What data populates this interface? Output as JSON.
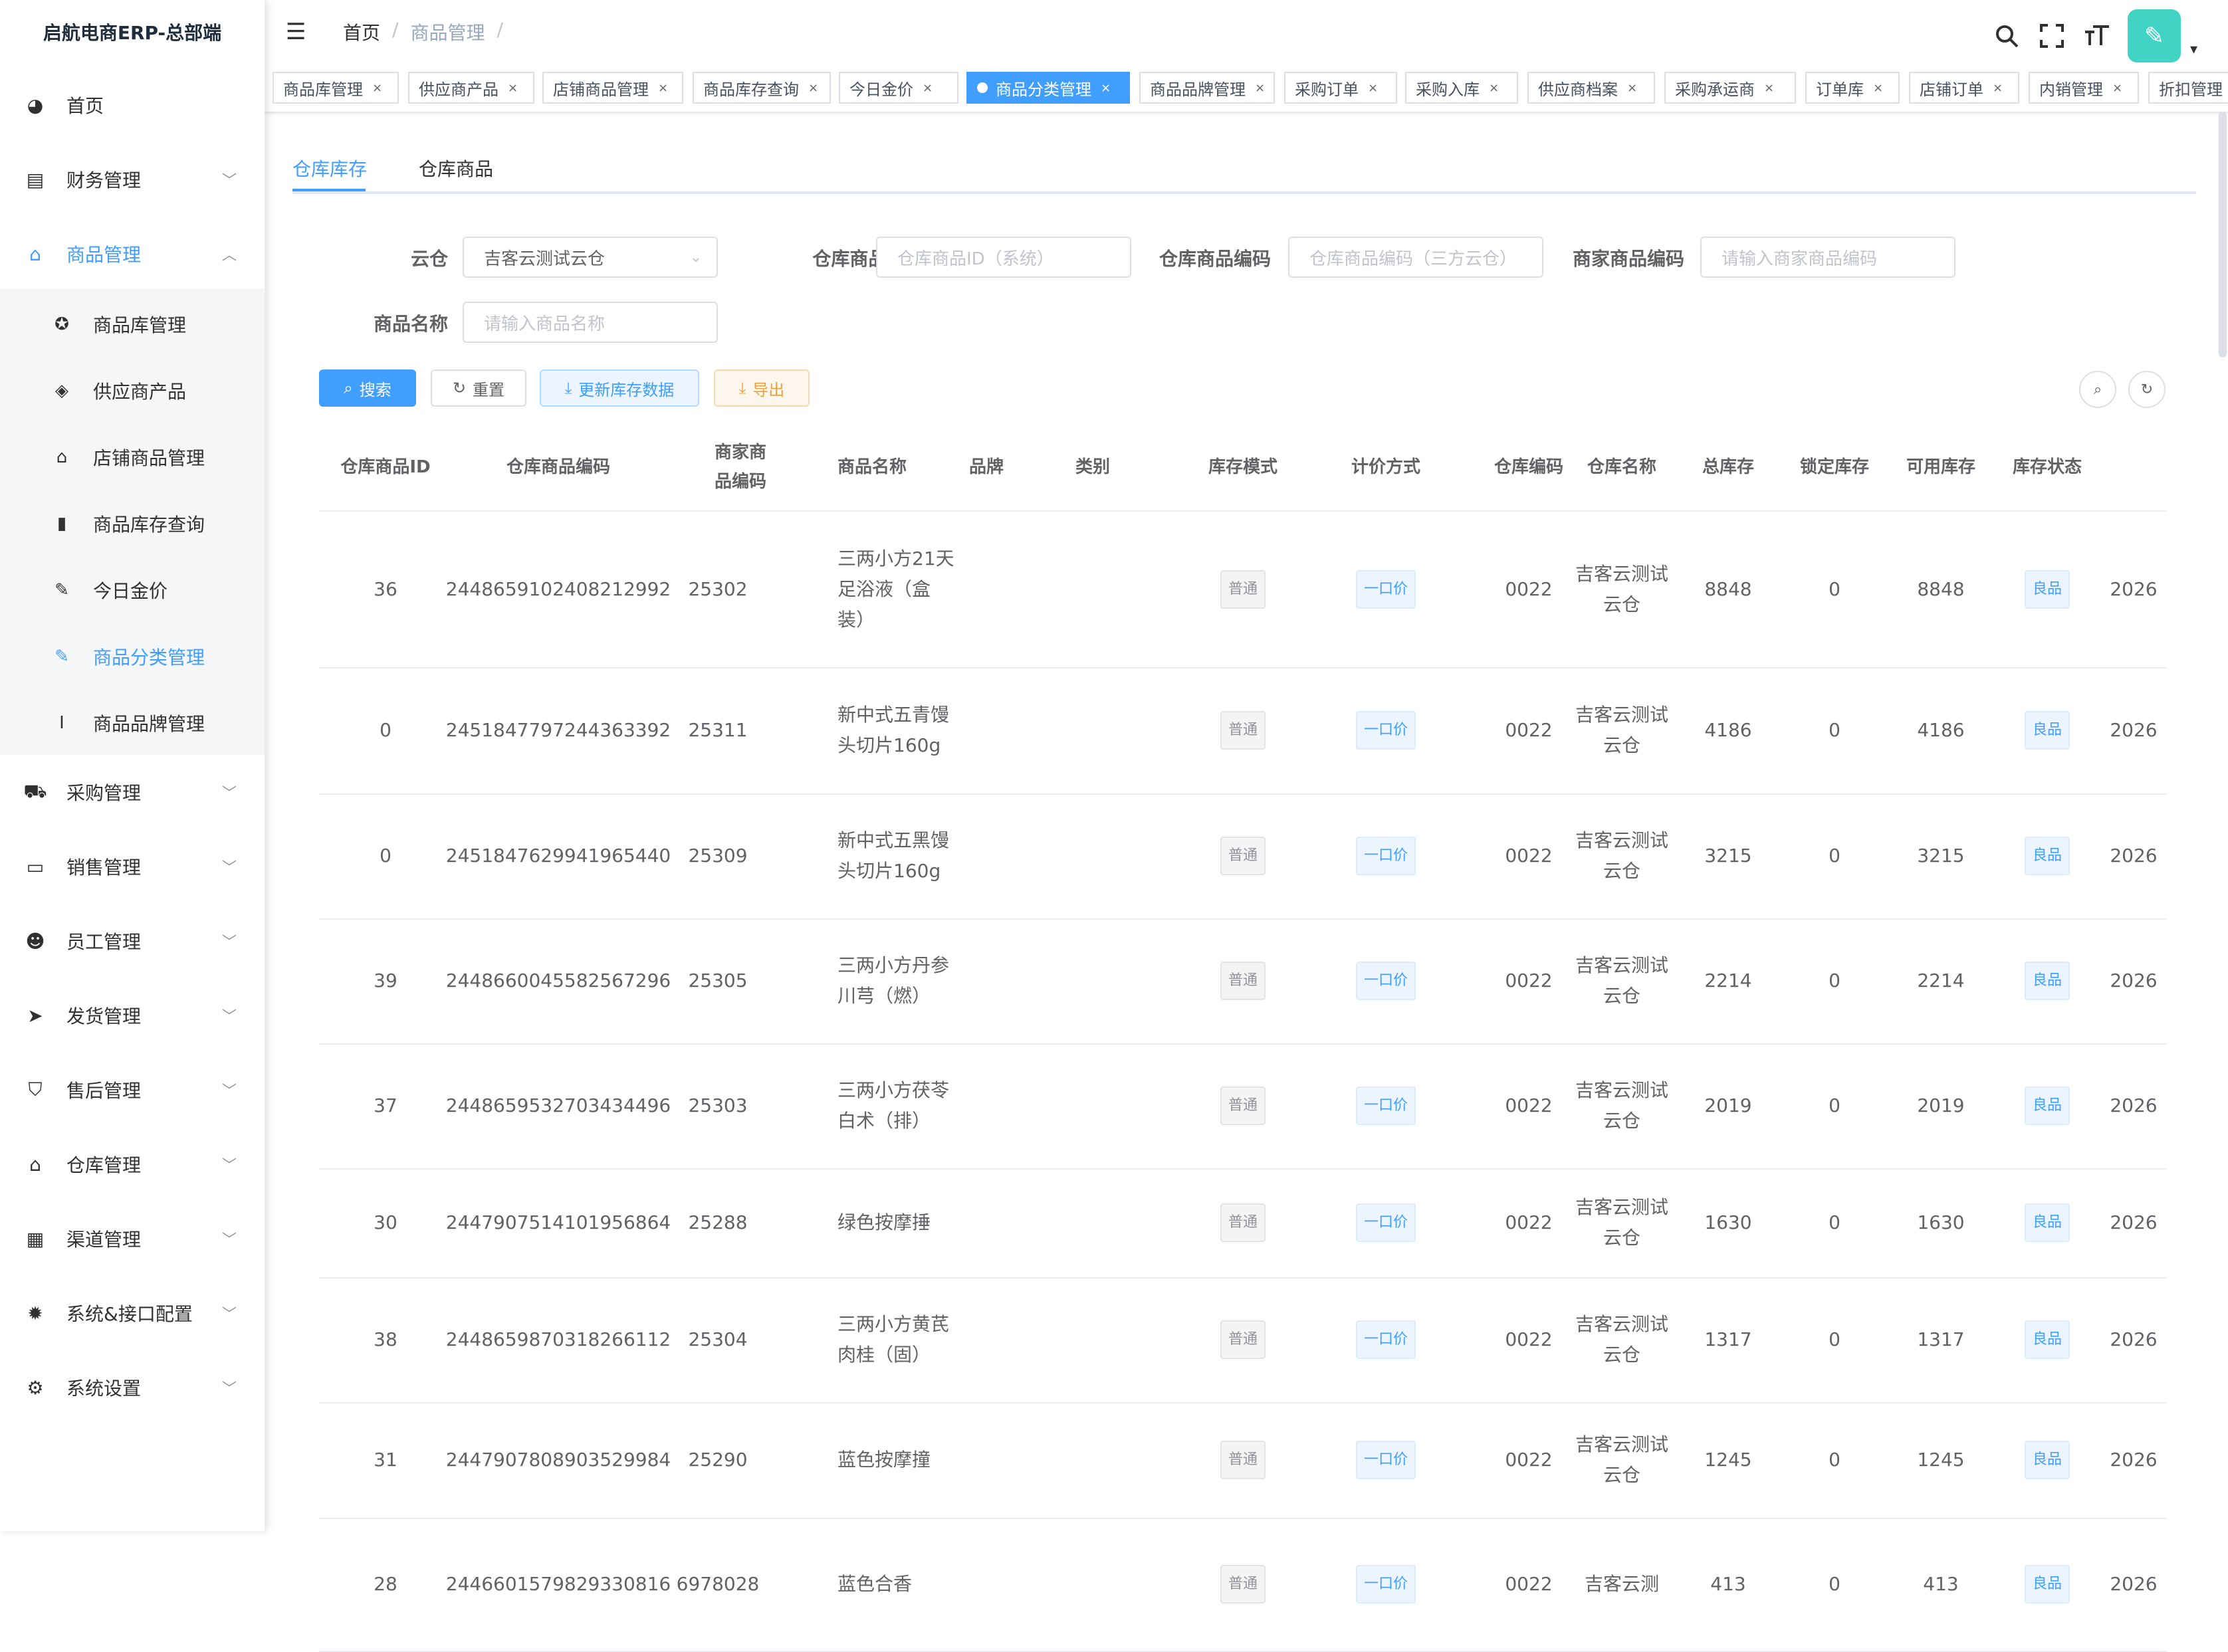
{
  "app": {
    "title": "启航电商ERP-总部端"
  },
  "sidebar": {
    "items": [
      {
        "icon": "dashboard-icon",
        "label": "首页"
      },
      {
        "icon": "finance-icon",
        "label": "财务管理"
      },
      {
        "icon": "goods-icon",
        "label": "商品管理"
      },
      {
        "icon": "cart-icon",
        "label": "采购管理"
      },
      {
        "icon": "sales-icon",
        "label": "销售管理"
      },
      {
        "icon": "staff-icon",
        "label": "员工管理"
      },
      {
        "icon": "send-icon",
        "label": "发货管理"
      },
      {
        "icon": "aftersale-icon",
        "label": "售后管理"
      },
      {
        "icon": "warehouse-icon",
        "label": "仓库管理"
      },
      {
        "icon": "channel-icon",
        "label": "渠道管理"
      },
      {
        "icon": "system-api-icon",
        "label": "系统&接口配置"
      },
      {
        "icon": "settings-icon",
        "label": "系统设置"
      }
    ],
    "submenu": [
      {
        "icon": "library-icon",
        "label": "商品库管理"
      },
      {
        "icon": "supplier-icon",
        "label": "供应商产品"
      },
      {
        "icon": "shop-icon",
        "label": "店铺商品管理"
      },
      {
        "icon": "bar-chart-icon",
        "label": "商品库存查询"
      },
      {
        "icon": "gold-price-icon",
        "label": "今日金价"
      },
      {
        "icon": "edit-icon",
        "label": "商品分类管理"
      },
      {
        "icon": "brand-icon",
        "label": "商品品牌管理"
      }
    ]
  },
  "header": {
    "breadcrumb": {
      "home": "首页",
      "sep1": "/",
      "current": "商品管理",
      "sep2": "/"
    },
    "hamburger": "☰",
    "search": "⌕",
    "fullscreen": "⛶",
    "fontsize": "тT",
    "avatar": "✎",
    "caret": "▾"
  },
  "tags": [
    {
      "label": "商品库管理",
      "close": "×"
    },
    {
      "label": "供应商产品",
      "close": "×"
    },
    {
      "label": "店铺商品管理",
      "close": "×"
    },
    {
      "label": "商品库存查询",
      "close": "×"
    },
    {
      "label": "今日金价",
      "close": "×"
    },
    {
      "label": "商品分类管理",
      "close": "×"
    },
    {
      "label": "商品品牌管理",
      "close": "×"
    },
    {
      "label": "采购订单",
      "close": "×"
    },
    {
      "label": "采购入库",
      "close": "×"
    },
    {
      "label": "供应商档案",
      "close": "×"
    },
    {
      "label": "采购承运商",
      "close": "×"
    },
    {
      "label": "订单库",
      "close": "×"
    },
    {
      "label": "店铺订单",
      "close": "×"
    },
    {
      "label": "内销管理",
      "close": "×"
    },
    {
      "label": "折扣管理",
      "close": ""
    }
  ],
  "tabs": [
    {
      "label": "仓库库存"
    },
    {
      "label": "仓库商品"
    }
  ],
  "form": {
    "cloud_warehouse": {
      "label": "云仓",
      "value": "吉客云测试云仓"
    },
    "warehouse_goods_id": {
      "label": "仓库商品ID",
      "placeholder": "仓库商品ID（系统）"
    },
    "warehouse_goods_code": {
      "label": "仓库商品编码",
      "placeholder": "仓库商品编码（三方云仓）"
    },
    "merchant_goods_code": {
      "label": "商家商品编码",
      "placeholder": "请输入商家商品编码"
    },
    "goods_name": {
      "label": "商品名称",
      "placeholder": "请输入商品名称"
    }
  },
  "buttons": {
    "search": "搜索",
    "reset": "重置",
    "update": "更新库存数据",
    "export": "导出"
  },
  "table": {
    "columns": [
      "仓库商品ID",
      "仓库商品编码",
      "商家商品编码",
      "商品名称",
      "品牌",
      "类别",
      "库存模式",
      "计价方式",
      "仓库编码",
      "仓库名称",
      "总库存",
      "锁定库存",
      "可用库存",
      "库存状态"
    ],
    "rows": [
      {
        "id": "36",
        "code": "2448659102408212992",
        "mcode": "25302",
        "name": "三两小方21天足浴液（盒装）",
        "brand": "",
        "category": "",
        "mode": "普通",
        "pricing": "一口价",
        "wcode": "0022",
        "wname": "吉客云测试云仓",
        "total": "8848",
        "locked": "0",
        "avail": "8848",
        "status": "良品",
        "date": "2026"
      },
      {
        "id": "0",
        "code": "2451847797244363392",
        "mcode": "25311",
        "name": "新中式五青馒头切片160g",
        "brand": "",
        "category": "",
        "mode": "普通",
        "pricing": "一口价",
        "wcode": "0022",
        "wname": "吉客云测试云仓",
        "total": "4186",
        "locked": "0",
        "avail": "4186",
        "status": "良品",
        "date": "2026"
      },
      {
        "id": "0",
        "code": "2451847629941965440",
        "mcode": "25309",
        "name": "新中式五黑馒头切片160g",
        "brand": "",
        "category": "",
        "mode": "普通",
        "pricing": "一口价",
        "wcode": "0022",
        "wname": "吉客云测试云仓",
        "total": "3215",
        "locked": "0",
        "avail": "3215",
        "status": "良品",
        "date": "2026"
      },
      {
        "id": "39",
        "code": "2448660045582567296",
        "mcode": "25305",
        "name": "三两小方丹参川芎（燃）",
        "brand": "",
        "category": "",
        "mode": "普通",
        "pricing": "一口价",
        "wcode": "0022",
        "wname": "吉客云测试云仓",
        "total": "2214",
        "locked": "0",
        "avail": "2214",
        "status": "良品",
        "date": "2026"
      },
      {
        "id": "37",
        "code": "2448659532703434496",
        "mcode": "25303",
        "name": "三两小方茯苓白术（排）",
        "brand": "",
        "category": "",
        "mode": "普通",
        "pricing": "一口价",
        "wcode": "0022",
        "wname": "吉客云测试云仓",
        "total": "2019",
        "locked": "0",
        "avail": "2019",
        "status": "良品",
        "date": "2026"
      },
      {
        "id": "30",
        "code": "2447907514101956864",
        "mcode": "25288",
        "name": "绿色按摩捶",
        "brand": "",
        "category": "",
        "mode": "普通",
        "pricing": "一口价",
        "wcode": "0022",
        "wname": "吉客云测试云仓",
        "total": "1630",
        "locked": "0",
        "avail": "1630",
        "status": "良品",
        "date": "2026"
      },
      {
        "id": "38",
        "code": "2448659870318266112",
        "mcode": "25304",
        "name": "三两小方黄芪肉桂（固）",
        "brand": "",
        "category": "",
        "mode": "普通",
        "pricing": "一口价",
        "wcode": "0022",
        "wname": "吉客云测试云仓",
        "total": "1317",
        "locked": "0",
        "avail": "1317",
        "status": "良品",
        "date": "2026"
      },
      {
        "id": "31",
        "code": "2447907808903529984",
        "mcode": "25290",
        "name": "蓝色按摩撞",
        "brand": "",
        "category": "",
        "mode": "普通",
        "pricing": "一口价",
        "wcode": "0022",
        "wname": "吉客云测试云仓",
        "total": "1245",
        "locked": "0",
        "avail": "1245",
        "status": "良品",
        "date": "2026"
      },
      {
        "id": "28",
        "code": "2446601579829330816",
        "mcode": "6978028",
        "name": "蓝色合香",
        "brand": "",
        "category": "",
        "mode": "普通",
        "pricing": "一口价",
        "wcode": "0022",
        "wname": "吉客云测",
        "total": "413",
        "locked": "0",
        "avail": "413",
        "status": "良品",
        "date": "2026"
      }
    ]
  },
  "colors": {
    "accent": "#409eff",
    "warning": "#e6a23c",
    "avatar": "#41d3c4"
  }
}
